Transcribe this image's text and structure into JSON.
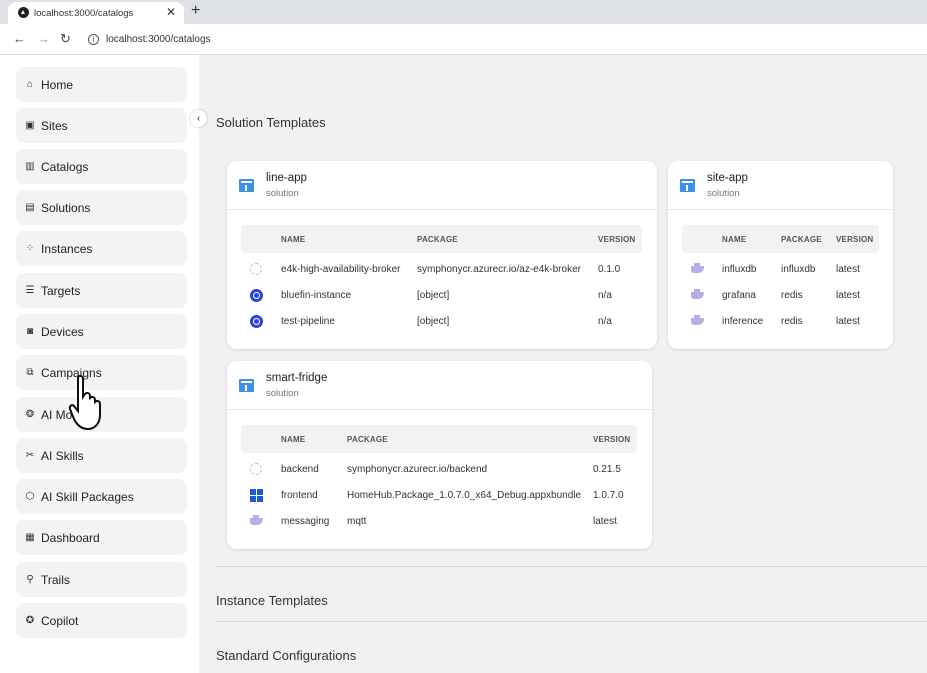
{
  "browser": {
    "tab_title": "localhost:3000/catalogs",
    "tab_close": "✕",
    "new_tab": "+",
    "url": "localhost:3000/catalogs"
  },
  "sidebar": {
    "items": [
      {
        "label": "Home",
        "icon": "⌂"
      },
      {
        "label": "Sites",
        "icon": "▣"
      },
      {
        "label": "Catalogs",
        "icon": "▥"
      },
      {
        "label": "Solutions",
        "icon": "▤"
      },
      {
        "label": "Instances",
        "icon": "⁘"
      },
      {
        "label": "Targets",
        "icon": "☰"
      },
      {
        "label": "Devices",
        "icon": "◙"
      },
      {
        "label": "Campaigns",
        "icon": "⧉"
      },
      {
        "label": "AI Models",
        "icon": "❂"
      },
      {
        "label": "AI Skills",
        "icon": "✂"
      },
      {
        "label": "AI Skill Packages",
        "icon": "⬡"
      },
      {
        "label": "Dashboard",
        "icon": "▦"
      },
      {
        "label": "Trails",
        "icon": "⚲"
      },
      {
        "label": "Copilot",
        "icon": "✪"
      }
    ],
    "collapse_icon": "‹"
  },
  "main": {
    "sections": {
      "solution_templates": "Solution Templates",
      "instance_templates": "Instance Templates",
      "standard_configurations": "Standard Configurations"
    },
    "cards": [
      {
        "name": "line-app",
        "type": "solution",
        "headers": [
          "NAME",
          "PACKAGE",
          "VERSION"
        ],
        "rows": [
          {
            "icon": "helm-icon",
            "name": "e4k-high-availability-broker",
            "package": "symphonycr.azurecr.io/az-e4k-broker",
            "version": "0.1.0"
          },
          {
            "icon": "kubernetes-icon",
            "name": "bluefin-instance",
            "package": "[object]",
            "version": "n/a"
          },
          {
            "icon": "kubernetes-icon",
            "name": "test-pipeline",
            "package": "[object]",
            "version": "n/a"
          }
        ]
      },
      {
        "name": "site-app",
        "type": "solution",
        "headers": [
          "NAME",
          "PACKAGE",
          "VERSION"
        ],
        "rows": [
          {
            "icon": "docker-icon",
            "name": "influxdb",
            "package": "influxdb",
            "version": "latest"
          },
          {
            "icon": "docker-icon",
            "name": "grafana",
            "package": "redis",
            "version": "latest"
          },
          {
            "icon": "docker-icon",
            "name": "inference",
            "package": "redis",
            "version": "latest"
          }
        ]
      },
      {
        "name": "smart-fridge",
        "type": "solution",
        "headers": [
          "NAME",
          "PACKAGE",
          "VERSION"
        ],
        "rows": [
          {
            "icon": "helm-icon",
            "name": "backend",
            "package": "symphonycr.azurecr.io/backend",
            "version": "0.21.5"
          },
          {
            "icon": "windows-icon",
            "name": "frontend",
            "package": "HomeHub.Package_1.0.7.0_x64_Debug.appxbundle",
            "version": "1.0.7.0"
          },
          {
            "icon": "docker-icon",
            "name": "messaging",
            "package": "mqtt",
            "version": "latest"
          }
        ]
      }
    ]
  }
}
